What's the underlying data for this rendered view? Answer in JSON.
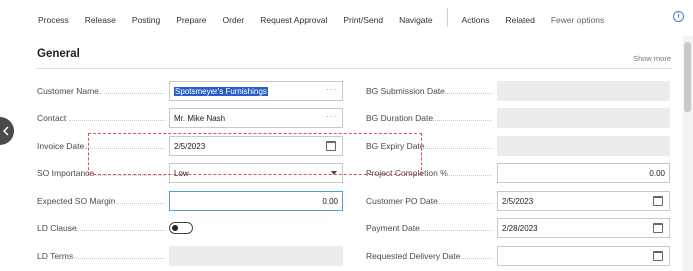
{
  "actions": {
    "items": [
      "Process",
      "Release",
      "Posting",
      "Prepare",
      "Order",
      "Request Approval",
      "Print/Send",
      "Navigate"
    ],
    "secondary": [
      "Actions",
      "Related"
    ],
    "fewer": "Fewer options"
  },
  "section": {
    "title": "General",
    "show_more": "Show more"
  },
  "left": {
    "customer_name": {
      "label": "Customer Name",
      "value": "Spotsmeyer's Furnishings"
    },
    "contact": {
      "label": "Contact",
      "value": "Mr. Mike Nash"
    },
    "invoice_date": {
      "label": "Invoice Date",
      "value": "2/5/2023"
    },
    "so_importance": {
      "label": "SO Importance",
      "value": "Low"
    },
    "expected_so_margin": {
      "label": "Expected SO Margin",
      "value": "0.00"
    },
    "ld_clause": {
      "label": "LD Clause"
    },
    "ld_terms": {
      "label": "LD Terms"
    }
  },
  "right": {
    "bg_submission_date": {
      "label": "BG Submission Date"
    },
    "bg_duration_date": {
      "label": "BG Duration Date"
    },
    "bg_expiry_date": {
      "label": "BG Expiry Date"
    },
    "project_completion": {
      "label": "Project Completion %",
      "value": "0.00"
    },
    "customer_po_date": {
      "label": "Customer PO Date",
      "value": "2/5/2023"
    },
    "payment_date": {
      "label": "Payment Date",
      "value": "2/28/2023"
    },
    "requested_delivery_date": {
      "label": "Requested Delivery Date"
    }
  }
}
